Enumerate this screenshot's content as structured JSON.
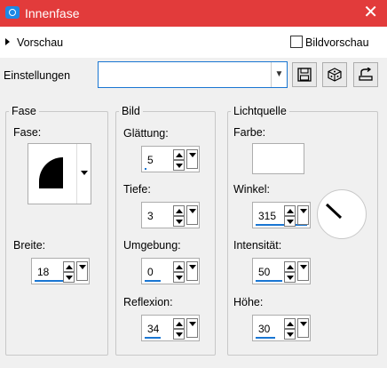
{
  "window": {
    "title": "Innenfase",
    "close_glyph": "✕"
  },
  "preview": {
    "label": "Vorschau",
    "bildvorschau_label": "Bildvorschau",
    "bildvorschau_checked": false
  },
  "settings": {
    "label": "Einstellungen",
    "value": ""
  },
  "fase": {
    "legend": "Fase",
    "fase_label": "Fase:",
    "breite_label": "Breite:",
    "breite_value": "18"
  },
  "bild": {
    "legend": "Bild",
    "glaettung_label": "Glättung:",
    "glaettung_value": "5",
    "tiefe_label": "Tiefe:",
    "tiefe_value": "3",
    "umgebung_label": "Umgebung:",
    "umgebung_value": "0",
    "reflexion_label": "Reflexion:",
    "reflexion_value": "34"
  },
  "licht": {
    "legend": "Lichtquelle",
    "farbe_label": "Farbe:",
    "farbe_color": "#ffffff",
    "winkel_label": "Winkel:",
    "winkel_value": "315",
    "intensitaet_label": "Intensität:",
    "intensitaet_value": "50",
    "hoehe_label": "Höhe:",
    "hoehe_value": "30"
  },
  "colors": {
    "titlebar": "#e23b3b",
    "accent": "#1976d2"
  }
}
